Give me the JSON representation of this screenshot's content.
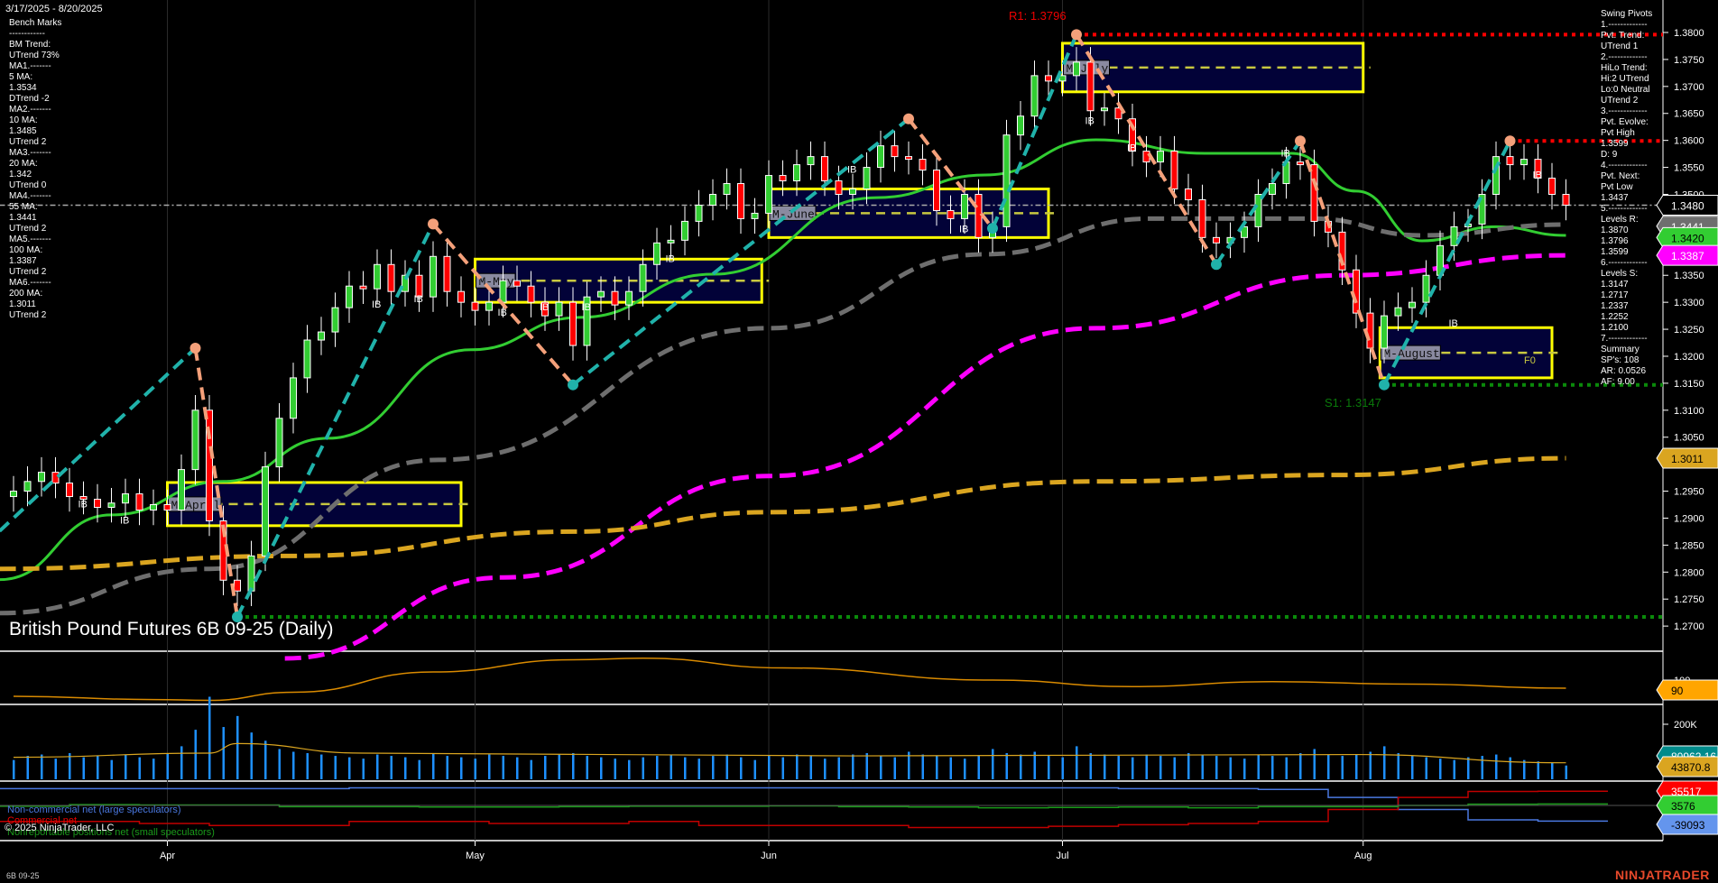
{
  "header": {
    "date_range": "3/17/2025 - 8/20/2025",
    "title": "British Pound Futures 6B 09-25 (Daily)"
  },
  "bench_marks": [
    "Bench Marks",
    "------------",
    "BM Trend:",
    "UTrend 73%",
    "MA1.-------",
    "5 MA:",
    "1.3534",
    "DTrend -2",
    "MA2.-------",
    "10 MA:",
    "1.3485",
    "UTrend 2",
    "MA3.-------",
    "20 MA:",
    "1.342",
    "UTrend 0",
    "MA4.-------",
    "55 MA:",
    "1.3441",
    "UTrend 2",
    "MA5.-------",
    "100 MA:",
    "1.3387",
    "UTrend 2",
    "MA6.-------",
    "200 MA:",
    "1.3011",
    "UTrend 2"
  ],
  "swing_pivots": [
    "Swing Pivots",
    "1.-------------",
    "Pvt. Trend:",
    "UTrend 1",
    "2.-------------",
    "HiLo Trend:",
    "Hi:2 UTrend",
    "Lo:0 Neutral",
    "UTrend 2",
    "3.-------------",
    "Pvt. Evolve:",
    "Pvt High",
    "1.3599",
    "D: 9",
    "4.-------------",
    "Pvt. Next:",
    "Pvt Low",
    "1.3437",
    "5.-------------",
    "Levels R:",
    "1.3870",
    "1.3796",
    "1.3599",
    "6.-------------",
    "Levels S:",
    "1.3147",
    "1.2717",
    "1.2337",
    "1.2252",
    "1.2100",
    "7.-------------",
    "Summary",
    "SP's: 108",
    "AR: 0.0526",
    "AF: 9.00"
  ],
  "annotations": {
    "r1": "R1: 1.3796",
    "s1": "S1: 1.3147",
    "f0": "F0",
    "ib": "IB"
  },
  "price_tags": [
    {
      "value": "1.3480",
      "color": "#000000",
      "text": "#ffffff"
    },
    {
      "value": "1.3441",
      "color": "#6e6e6e",
      "text": "#ffffff"
    },
    {
      "value": "1.3420",
      "color": "#32cd32",
      "text": "#000000"
    },
    {
      "value": "1.3387",
      "color": "#ff00ff",
      "text": "#ffffff"
    },
    {
      "value": "1.3011",
      "color": "#daa520",
      "text": "#000000"
    }
  ],
  "indicator_tags": [
    {
      "value": "90",
      "color": "#ffa500",
      "text": "#000000"
    },
    {
      "value": "80962.16",
      "color": "#008b8b",
      "text": "#ffffff"
    },
    {
      "value": "43870.8",
      "color": "#daa520",
      "text": "#000000"
    },
    {
      "value": "35517",
      "color": "#ff0000",
      "text": "#ffffff"
    },
    {
      "value": "3576",
      "color": "#32cd32",
      "text": "#000000"
    },
    {
      "value": "-39093",
      "color": "#6495ed",
      "text": "#000000"
    }
  ],
  "legend": {
    "noncommercial": "Non-commercial net (large speculators)",
    "commercial": "Commercial net",
    "nonreportable": "Nonreportable positions net (small speculators)",
    "copyright": "© 2025 NinjaTrader, LLC"
  },
  "footer": {
    "symbol": "6B 09-25",
    "logo": "NINJATRADER"
  },
  "chart_data": {
    "type": "candlestick",
    "title": "British Pound Futures 6B 09-25 (Daily)",
    "ylim": [
      1.265,
      1.386
    ],
    "y_ticks": [
      "1.3800",
      "1.3750",
      "1.3700",
      "1.3650",
      "1.3600",
      "1.3550",
      "1.3500",
      "1.3450",
      "1.3400",
      "1.3350",
      "1.3300",
      "1.3250",
      "1.3200",
      "1.3150",
      "1.3100",
      "1.3050",
      "1.3000",
      "1.2950",
      "1.2900",
      "1.2850",
      "1.2800",
      "1.2750",
      "1.2700"
    ],
    "x_ticks": [
      {
        "label": "Apr",
        "index": 11
      },
      {
        "label": "May",
        "index": 33
      },
      {
        "label": "Jun",
        "index": 54
      },
      {
        "label": "Jul",
        "index": 75
      },
      {
        "label": "Aug",
        "index": 96.5
      }
    ],
    "closes": [
      1.295,
      1.2968,
      1.2985,
      1.2965,
      1.294,
      1.2935,
      1.292,
      1.2928,
      1.2945,
      1.2915,
      1.2925,
      1.2915,
      1.299,
      1.31,
      1.2895,
      1.2785,
      1.2765,
      1.283,
      1.2995,
      1.3085,
      1.316,
      1.323,
      1.3245,
      1.329,
      1.333,
      1.3325,
      1.337,
      1.332,
      1.335,
      1.331,
      1.3385,
      1.332,
      1.33,
      1.3285,
      1.33,
      1.334,
      1.333,
      1.33,
      1.3275,
      1.33,
      1.322,
      1.331,
      1.332,
      1.3295,
      1.332,
      1.337,
      1.341,
      1.3415,
      1.345,
      1.348,
      1.35,
      1.352,
      1.3455,
      1.3465,
      1.3535,
      1.3525,
      1.3555,
      1.357,
      1.3525,
      1.35,
      1.351,
      1.355,
      1.359,
      1.357,
      1.3565,
      1.3545,
      1.347,
      1.3455,
      1.35,
      1.342,
      1.344,
      1.361,
      1.3645,
      1.372,
      1.371,
      1.372,
      1.3745,
      1.3655,
      1.366,
      1.364,
      1.358,
      1.356,
      1.358,
      1.351,
      1.349,
      1.342,
      1.341,
      1.342,
      1.344,
      1.35,
      1.352,
      1.356,
      1.3555,
      1.345,
      1.343,
      1.336,
      1.328,
      1.3215,
      1.3275,
      1.329,
      1.33,
      1.335,
      1.3405,
      1.344,
      1.3445,
      1.35,
      1.357,
      1.3555,
      1.3565,
      1.353,
      1.35,
      1.348
    ],
    "first_open": 1.294,
    "moving_averages": [
      {
        "name": "20 MA",
        "color": "#32cd32",
        "dash": "solid",
        "points": [
          [
            -1,
            1.2786
          ],
          [
            7,
            1.2906
          ],
          [
            15,
            1.2968
          ],
          [
            22.5,
            1.3048
          ],
          [
            32.7,
            1.3212
          ],
          [
            40.5,
            1.3272
          ],
          [
            50,
            1.3352
          ],
          [
            61.7,
            1.3494
          ],
          [
            69.5,
            1.3536
          ],
          [
            77.4,
            1.3601
          ],
          [
            85.2,
            1.3576
          ],
          [
            91.4,
            1.3576
          ],
          [
            96,
            1.3506
          ],
          [
            100.7,
            1.3414
          ],
          [
            106,
            1.344
          ],
          [
            111,
            1.3424
          ]
        ]
      },
      {
        "name": "55 MA",
        "color": "#6e6e6e",
        "dash": "dashed",
        "points": [
          [
            -1,
            1.2724
          ],
          [
            14,
            1.2806
          ],
          [
            30.4,
            1.3008
          ],
          [
            54,
            1.3252
          ],
          [
            69.5,
            1.3389
          ],
          [
            81.3,
            1.3455
          ],
          [
            92.9,
            1.3455
          ],
          [
            100.7,
            1.3424
          ],
          [
            111,
            1.3444
          ]
        ]
      },
      {
        "name": "100 MA",
        "color": "#ff00ff",
        "dash": "dashed",
        "points": [
          [
            19.4,
            1.264
          ],
          [
            35,
            1.279
          ],
          [
            54,
            1.2978
          ],
          [
            77.4,
            1.3252
          ],
          [
            95,
            1.335
          ],
          [
            111,
            1.3387
          ]
        ]
      },
      {
        "name": "200 MA",
        "color": "#daa520",
        "dash": "dashed",
        "points": [
          [
            -1,
            1.2806
          ],
          [
            20,
            1.283
          ],
          [
            40,
            1.2875
          ],
          [
            54,
            1.2911
          ],
          [
            77.4,
            1.2968
          ],
          [
            95,
            1.298
          ],
          [
            111,
            1.3011
          ]
        ]
      }
    ],
    "swing_pivots": [
      [
        -1,
        1.2876
      ],
      [
        13,
        1.3215
      ],
      [
        16,
        1.2717
      ],
      [
        30,
        1.3445
      ],
      [
        40,
        1.3147
      ],
      [
        64,
        1.364
      ],
      [
        70,
        1.3437
      ],
      [
        76,
        1.3796
      ],
      [
        86,
        1.337
      ],
      [
        92,
        1.3599
      ],
      [
        98,
        1.3147
      ],
      [
        107,
        1.3599
      ]
    ],
    "monthly_boxes": [
      {
        "label": "M-April",
        "start": 11,
        "end": 32,
        "high": 1.2966,
        "low": 1.2886
      },
      {
        "label": "M-May",
        "start": 33,
        "end": 53.5,
        "high": 1.338,
        "low": 1.33
      },
      {
        "label": "M-June",
        "start": 54,
        "end": 74,
        "high": 1.351,
        "low": 1.342
      },
      {
        "label": "M-July",
        "start": 75,
        "end": 96.5,
        "high": 1.378,
        "low": 1.369
      },
      {
        "label": "M-August",
        "start": 97.7,
        "end": 110,
        "high": 1.3253,
        "low": 1.316
      }
    ],
    "levels": [
      {
        "name": "R1",
        "value": 1.3796,
        "from": 76,
        "color": "#ff0000"
      },
      {
        "name": "S1",
        "value": 1.3147,
        "from": 98,
        "color": "#0a8a0a"
      },
      {
        "name": "S2",
        "value": 1.2717,
        "from": 16,
        "color": "#0a8a0a"
      },
      {
        "name": "Pvt High",
        "value": 1.3599,
        "from": 107,
        "color": "#ff0000"
      },
      {
        "name": "Last",
        "value": 1.348,
        "from": -1,
        "color": "#aaaaaa"
      }
    ],
    "ib_markers": [
      [
        5,
        1.292
      ],
      [
        8,
        1.289
      ],
      [
        26,
        1.329
      ],
      [
        29,
        1.33
      ],
      [
        35,
        1.3275
      ],
      [
        38,
        1.3285
      ],
      [
        41,
        1.3285
      ],
      [
        47,
        1.3375
      ],
      [
        60,
        1.354
      ],
      [
        68,
        1.343
      ],
      [
        77,
        1.363
      ],
      [
        80,
        1.358
      ],
      [
        91,
        1.357
      ],
      [
        103,
        1.3255
      ],
      [
        109,
        1.353
      ]
    ],
    "oscillator": {
      "label_tick": "100",
      "points": [
        [
          0,
          80
        ],
        [
          10,
          76
        ],
        [
          14,
          75
        ],
        [
          20,
          85
        ],
        [
          30,
          110
        ],
        [
          40,
          125
        ],
        [
          45,
          127
        ],
        [
          55,
          115
        ],
        [
          70,
          100
        ],
        [
          80,
          92
        ],
        [
          90,
          98
        ],
        [
          100,
          95
        ],
        [
          111,
          90
        ]
      ]
    },
    "volume": {
      "tick": "200K",
      "values": [
        70000,
        85000,
        90000,
        75000,
        95000,
        80000,
        85000,
        70000,
        90000,
        80000,
        75000,
        95000,
        120000,
        180000,
        300000,
        190000,
        230000,
        170000,
        140000,
        110000,
        100000,
        95000,
        90000,
        85000,
        80000,
        75000,
        90000,
        85000,
        80000,
        70000,
        95000,
        85000,
        80000,
        75000,
        90000,
        85000,
        80000,
        70000,
        85000,
        90000,
        95000,
        85000,
        80000,
        75000,
        70000,
        80000,
        85000,
        90000,
        80000,
        75000,
        85000,
        90000,
        80000,
        70000,
        85000,
        80000,
        90000,
        85000,
        75000,
        80000,
        90000,
        95000,
        85000,
        80000,
        100000,
        90000,
        85000,
        80000,
        75000,
        85000,
        110000,
        95000,
        90000,
        100000,
        85000,
        80000,
        120000,
        95000,
        90000,
        85000,
        80000,
        90000,
        85000,
        80000,
        95000,
        90000,
        85000,
        80000,
        75000,
        90000,
        85000,
        80000,
        95000,
        110000,
        90000,
        85000,
        90000,
        100000,
        120000,
        95000,
        85000,
        80000,
        75000,
        70000,
        80000,
        85000,
        90000,
        80000,
        70000,
        65000,
        60000,
        50000
      ],
      "average": [
        [
          0,
          80000
        ],
        [
          14,
          95000
        ],
        [
          16,
          130000
        ],
        [
          25,
          95000
        ],
        [
          60,
          85000
        ],
        [
          96,
          90000
        ],
        [
          111,
          60000
        ]
      ]
    },
    "cot": {
      "noncommercial": [
        42000,
        42000,
        42000,
        42000,
        42000,
        44000,
        44000,
        44000,
        44000,
        44000,
        44000,
        44000,
        44000,
        44000,
        44000,
        44000,
        42000,
        42000,
        40000,
        20000,
        -10000,
        -36000,
        -39093
      ],
      "commercial": [
        -40000,
        -40000,
        -45000,
        -50000,
        -50000,
        -40000,
        -40000,
        -45000,
        -45000,
        -40000,
        -50000,
        -50000,
        -50000,
        -55000,
        -55000,
        -52000,
        -48000,
        -45000,
        -40000,
        -10000,
        20000,
        35000,
        35517
      ],
      "nonreportable": [
        -2000,
        2000,
        1000,
        1000,
        -3000,
        -3000,
        -4000,
        -4000,
        -3000,
        -2000,
        -2000,
        -1000,
        -3000,
        -4000,
        -6000,
        -5000,
        -4000,
        -6000,
        -3000,
        -3000,
        0,
        3000,
        3576
      ]
    }
  }
}
